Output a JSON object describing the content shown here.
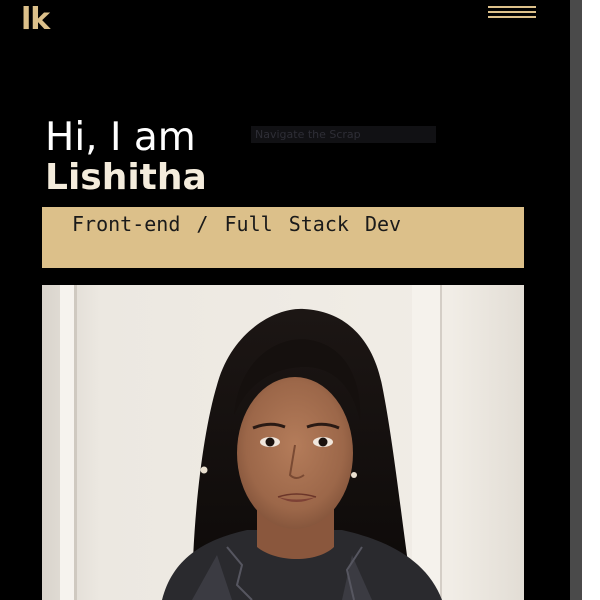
{
  "header": {
    "logo_text": "lk",
    "menu_icon": "hamburger-menu-icon"
  },
  "hero": {
    "greeting": "Hi, I am",
    "name": "Lishitha",
    "overlay_text": "Navigate the Scrap",
    "role": "Front-end / Full Stack Dev"
  },
  "colors": {
    "background": "#000000",
    "accent": "#dcc08a",
    "text": "#ffffff"
  }
}
